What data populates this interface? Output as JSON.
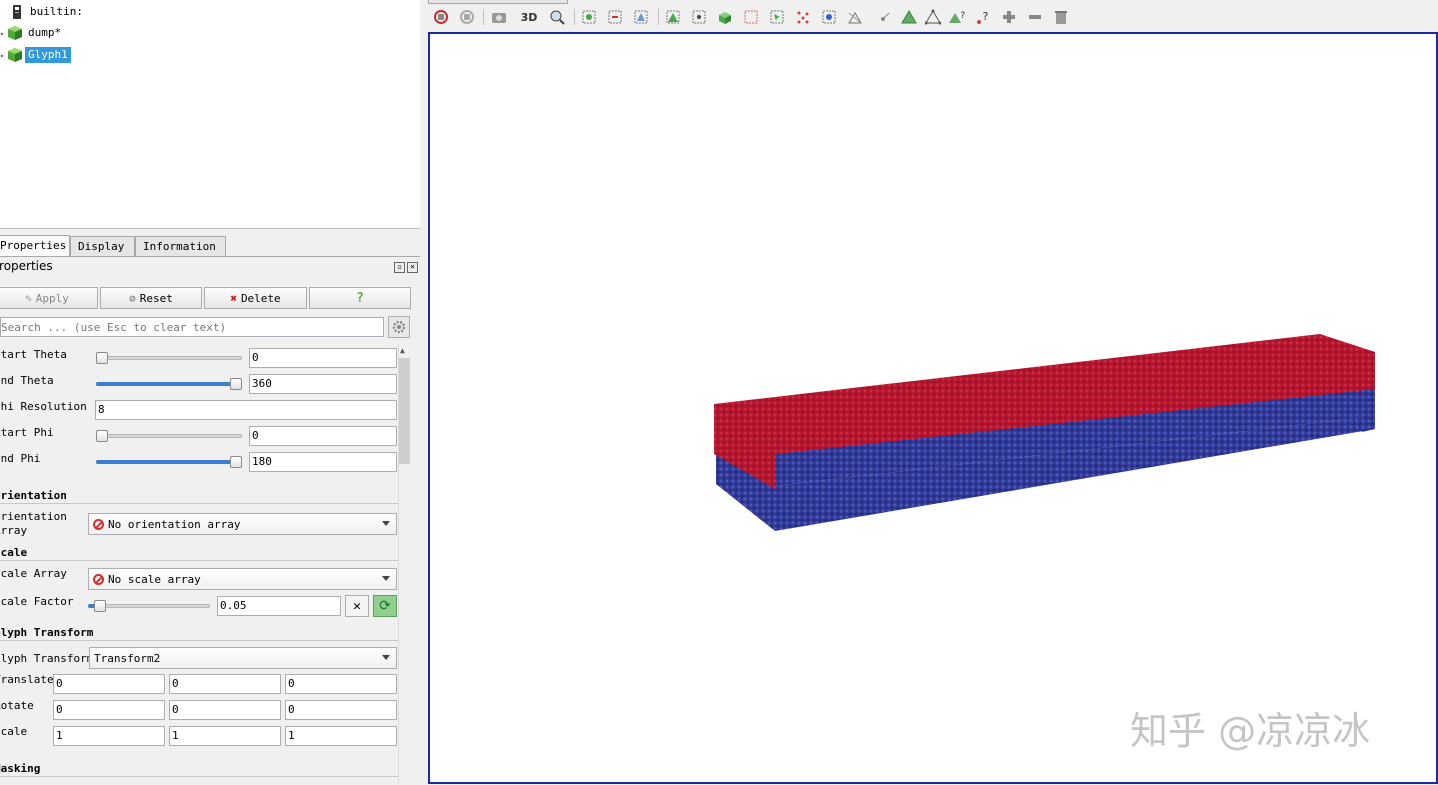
{
  "pipeline": {
    "items": [
      {
        "label": "builtin:"
      },
      {
        "label": "dump*"
      },
      {
        "label": "Glyph1"
      }
    ]
  },
  "tabs": [
    {
      "label": "Properties"
    },
    {
      "label": "Display"
    },
    {
      "label": "Information"
    }
  ],
  "panel": {
    "title": "Properties"
  },
  "buttons": {
    "apply": "Apply",
    "reset": "Reset",
    "delete": "Delete",
    "help": "?"
  },
  "search": {
    "placeholder": "Search ... (use Esc to clear text)"
  },
  "properties": {
    "start_theta": {
      "label": "Start Theta",
      "value": "0",
      "fraction": 0.0
    },
    "end_theta": {
      "label": "End Theta",
      "value": "360",
      "fraction": 1.0
    },
    "phi_resolution": {
      "label": "Phi Resolution",
      "value": "8"
    },
    "start_phi": {
      "label": "Start Phi",
      "value": "0",
      "fraction": 0.0
    },
    "end_phi": {
      "label": "End Phi",
      "value": "180",
      "fraction": 1.0
    }
  },
  "orientation": {
    "section": "Orientation",
    "label_line1": "Orientation",
    "label_line2": "Array",
    "value": "No orientation array"
  },
  "scale": {
    "section": "Scale",
    "array_label": "Scale Array",
    "array_value": "No scale array",
    "factor_label": "Scale Factor",
    "factor_value": "0.05",
    "factor_fraction": 0.05
  },
  "glyph_transform": {
    "section": "Glyph Transform",
    "label": "Glyph Transform",
    "value": "Transform2",
    "translate": {
      "label": "Translate",
      "values": [
        "0",
        "0",
        "0"
      ]
    },
    "rotate": {
      "label": "Rotate",
      "values": [
        "0",
        "0",
        "0"
      ]
    },
    "scale": {
      "label": "Scale",
      "values": [
        "1",
        "1",
        "1"
      ]
    }
  },
  "masking": {
    "section": "Masking"
  },
  "toolbar": {
    "label_3d": "3D"
  },
  "viewport": {
    "colors": {
      "top": "#a3122a",
      "bottom": "#2e3592",
      "frame": "#1c2a9a"
    }
  },
  "watermark": {
    "text": "知乎 @凉凉冰"
  }
}
